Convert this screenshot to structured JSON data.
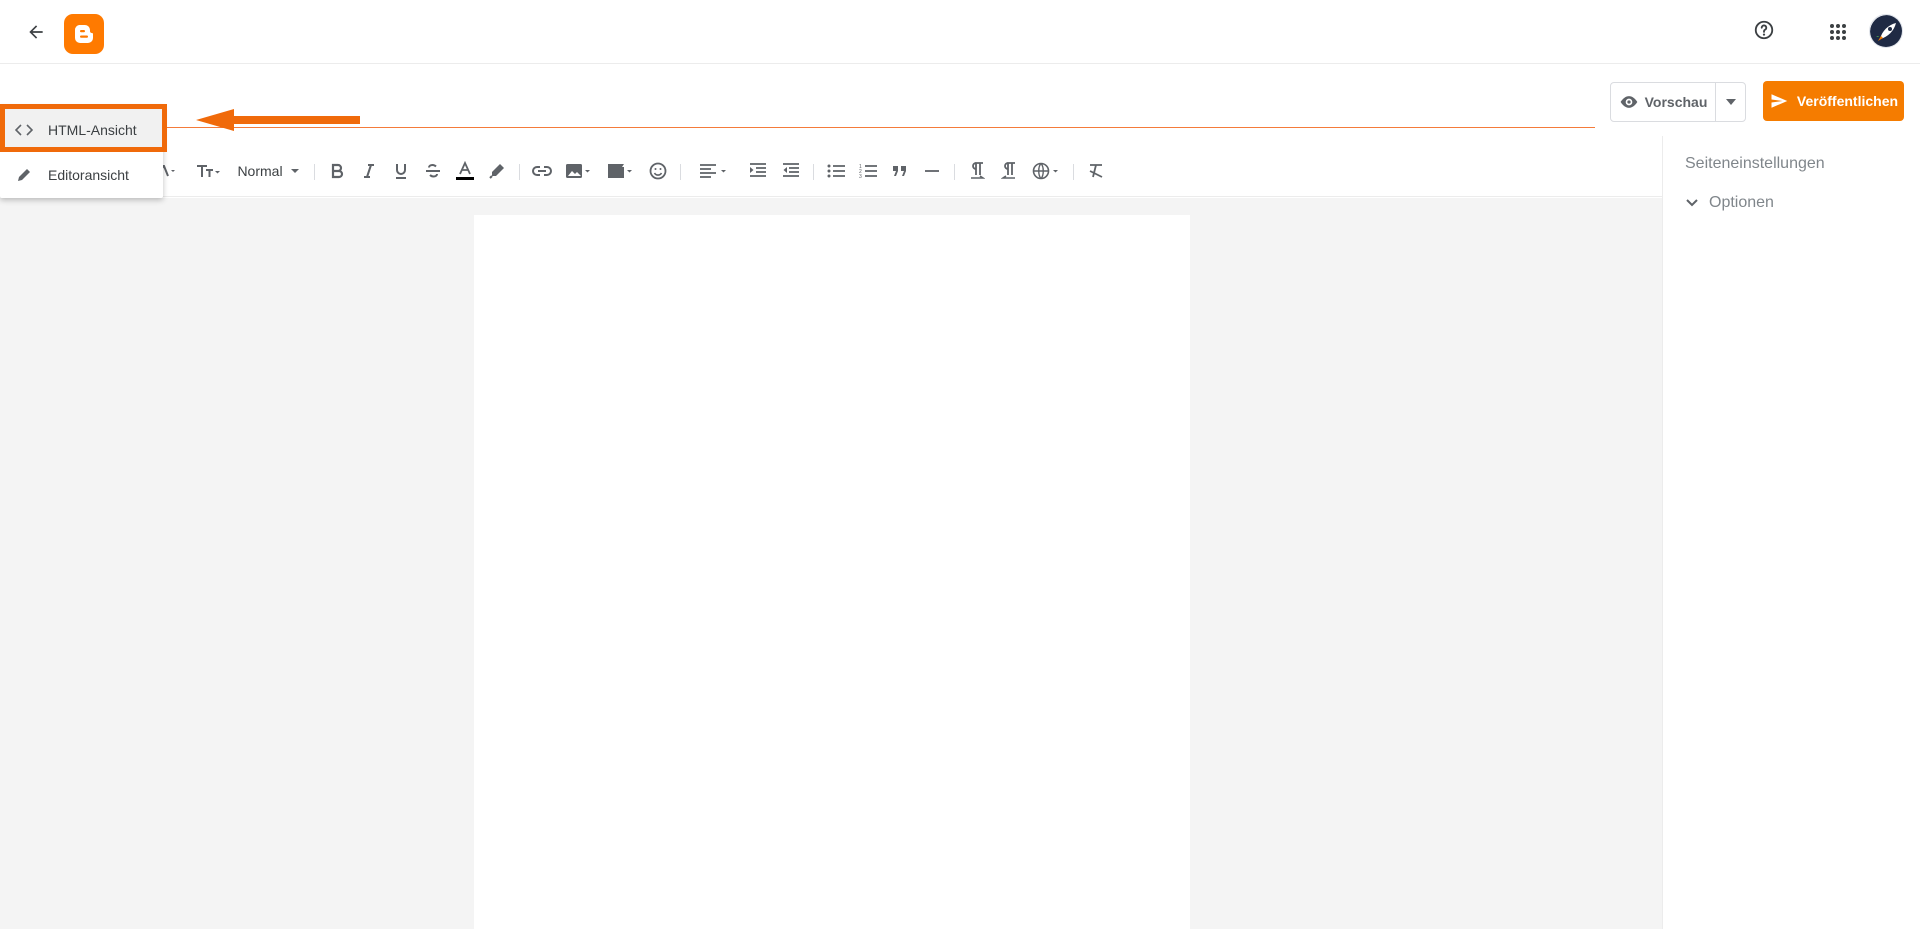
{
  "header": {
    "back_icon": "arrow-left-icon",
    "logo": "blogger-logo",
    "help_icon": "help-circle-icon",
    "apps_icon": "apps-grid-icon",
    "avatar": "rocket-avatar"
  },
  "actions": {
    "preview_label": "Vorschau",
    "publish_label": "Veröffentlichen"
  },
  "toolbar": {
    "format_label": "Normal"
  },
  "view_menu": {
    "items": [
      {
        "label": "HTML-Ansicht",
        "icon": "code-icon"
      },
      {
        "label": "Editoransicht",
        "icon": "pencil-icon"
      }
    ]
  },
  "side_panel": {
    "title": "Seiteneinstellungen",
    "options_label": "Optionen"
  },
  "colors": {
    "accent": "#f57c00",
    "highlight": "#f06a0a",
    "workspace": "#f4f4f4"
  }
}
